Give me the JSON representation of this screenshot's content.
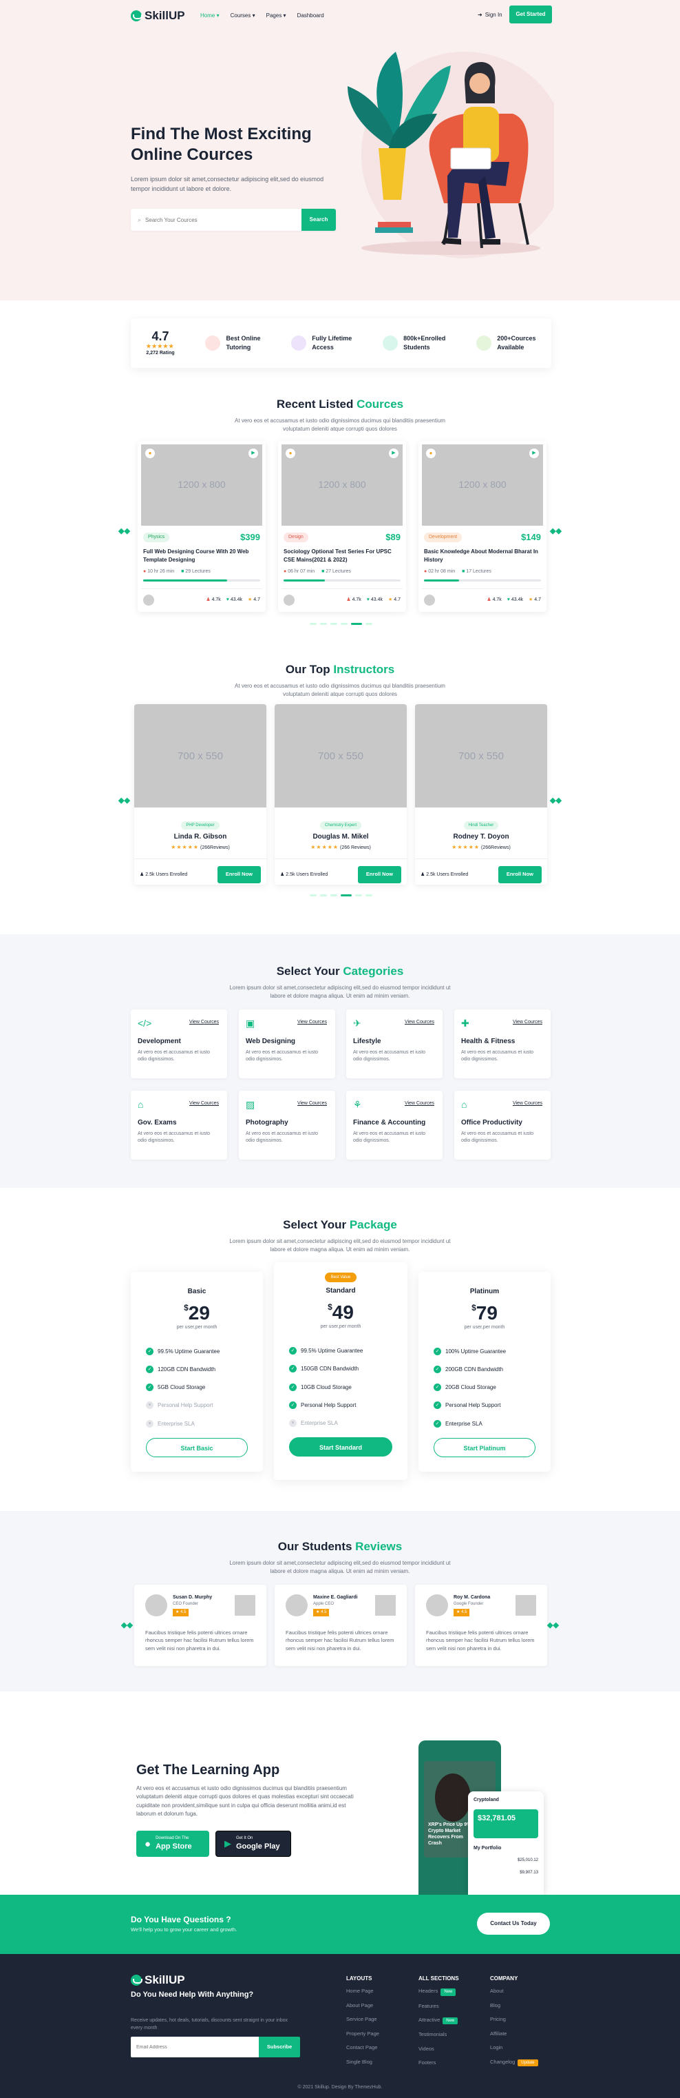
{
  "brand": {
    "name": "SkillUP"
  },
  "nav": {
    "items": [
      "Home",
      "Courses",
      "Pages",
      "Dashboard"
    ],
    "signin": "Sign In",
    "get_started": "Get Started"
  },
  "hero": {
    "title_line1": "Find The Most Exciting",
    "title_line2": "Online Cources",
    "text": "Lorem ipsum dolor sit amet,consectetur adipiscing elit,sed do eiusmod tempor incididunt ut labore et dolore.",
    "search_placeholder": "Search Your Cources",
    "search_button": "Search"
  },
  "stats": {
    "rating_value": "4.7",
    "rating_count": "2,272 Rating",
    "items": [
      {
        "l1": "Best Online",
        "l2": "Tutoring",
        "color": "#fde3e1"
      },
      {
        "l1": "Fully Lifetime",
        "l2": "Access",
        "color": "#ede4fb"
      },
      {
        "l1": "800k+Enrolled",
        "l2": "Students",
        "color": "#d9f6ec"
      },
      {
        "l1": "200+Cources",
        "l2": "Available",
        "color": "#e4f5dc"
      }
    ]
  },
  "courses": {
    "title_a": "Recent Listed",
    "title_b": "Cources",
    "sub": "At vero eos et accusamus et iusto odio dignissimos ducimus qui blanditiis praesentium voluptatum deleniti atque corrupti quos dolores",
    "placeholder": "1200 x 800",
    "items": [
      {
        "tag": "Physics",
        "tag_bg": "#e3f7ec",
        "tag_color": "#22a35b",
        "price": "$399",
        "title": "Full Web Designing Course With 20 Web Template Designing",
        "duration": "10 hr 26 min",
        "lectures": "29 Lectures",
        "progress": 0.72,
        "students": "4.7k",
        "likes": "43.4k",
        "rating": "4.7"
      },
      {
        "tag": "Design",
        "tag_bg": "#fde6e3",
        "tag_color": "#e0564b",
        "price": "$89",
        "title": "Sociology Optional Test Series For UPSC CSE Mains(2021 & 2022)",
        "duration": "06 hr 07 min",
        "lectures": "27 Lectures",
        "progress": 0.35,
        "students": "4.7k",
        "likes": "43.4k",
        "rating": "4.7"
      },
      {
        "tag": "Development",
        "tag_bg": "#fdebde",
        "tag_color": "#e4823a",
        "price": "$149",
        "title": "Basic Knowledge About Modernal Bharat In History",
        "duration": "02 hr 08 min",
        "lectures": "17 Lectures",
        "progress": 0.3,
        "students": "4.7k",
        "likes": "43.4k",
        "rating": "4.7"
      }
    ]
  },
  "instructors": {
    "title_a": "Our Top",
    "title_b": "Instructors",
    "sub": "At vero eos et accusamus et iusto odio dignissimos ducimus qui blanditiis praesentium voluptatum deleniti atque corrupti quos dolores",
    "placeholder": "700 x 550",
    "items": [
      {
        "role": "PHP Developer",
        "name": "Linda R. Gibson",
        "reviews": "(266Reviews)",
        "enrolled": "2.5k Users Enrolled",
        "btn": "Enroll Now"
      },
      {
        "role": "Chemistry Expert",
        "name": "Douglas M. Mikel",
        "reviews": "(266 Reviews)",
        "enrolled": "2.5k Users Enrolled",
        "btn": "Enroll Now"
      },
      {
        "role": "Hindi Teacher",
        "name": "Rodney T. Doyon",
        "reviews": "(266Reviews)",
        "enrolled": "2.5k Users Enrolled",
        "btn": "Enroll Now"
      }
    ]
  },
  "categories": {
    "title_a": "Select Your",
    "title_b": "Categories",
    "sub": "Lorem ipsum dolor sit amet,consectetur adipiscing elit,sed do eiusmod tempor incididunt ut labore et dolore magna aliqua. Ut enim ad minim veniam.",
    "view": "View Cources",
    "desc": "At vero eos et accusamus et iusto odio dignissimos.",
    "items": [
      {
        "name": "Development",
        "icon": "</>"
      },
      {
        "name": "Web Designing",
        "icon": "▣"
      },
      {
        "name": "Lifestyle",
        "icon": "✈"
      },
      {
        "name": "Health & Fitness",
        "icon": "✚"
      },
      {
        "name": "Gov. Exams",
        "icon": "⌂"
      },
      {
        "name": "Photography",
        "icon": "▨"
      },
      {
        "name": "Finance & Accounting",
        "icon": "⚘"
      },
      {
        "name": "Office Productivity",
        "icon": "⌂"
      }
    ]
  },
  "packages": {
    "title_a": "Select Your",
    "title_b": "Package",
    "sub": "Lorem ipsum dolor sit amet,consectetur adipiscing elit,sed do eiusmod tempor incididunt ut labore et dolore magna aliqua. Ut enim ad minim veniam.",
    "per": "per user,per month",
    "plans": [
      {
        "name": "Basic",
        "price": "29",
        "btn": "Start Basic",
        "features": [
          [
            "99.5% Uptime Guarantee",
            true
          ],
          [
            "120GB CDN Bandwidth",
            true
          ],
          [
            "5GB Cloud Storage",
            true
          ],
          [
            "Personal Help Support",
            false
          ],
          [
            "Enterprise SLA",
            false
          ]
        ]
      },
      {
        "name": "Standard",
        "badge": "Best Value",
        "price": "49",
        "btn": "Start Standard",
        "features": [
          [
            "99.5% Uptime Guarantee",
            true
          ],
          [
            "150GB CDN Bandwidth",
            true
          ],
          [
            "10GB Cloud Storage",
            true
          ],
          [
            "Personal Help Support",
            true
          ],
          [
            "Enterprise SLA",
            false
          ]
        ]
      },
      {
        "name": "Platinum",
        "price": "79",
        "btn": "Start Platinum",
        "features": [
          [
            "100% Uptime Guarantee",
            true
          ],
          [
            "200GB CDN Bandwidth",
            true
          ],
          [
            "20GB Cloud Storage",
            true
          ],
          [
            "Personal Help Support",
            true
          ],
          [
            "Enterprise SLA",
            true
          ]
        ]
      }
    ]
  },
  "reviews": {
    "title_a": "Our Students",
    "title_b": "Reviews",
    "sub": "Lorem ipsum dolor sit amet,consectetur adipiscing elit,sed do eiusmod tempor incididunt ut labore et dolore magna aliqua. Ut enim ad minim veniam.",
    "items": [
      {
        "name": "Susan D. Murphy",
        "role": "CEO Founder",
        "rating": "4.5",
        "text": "Faucibus tristique felis potenti ultrices ornare rhoncus semper hac facilisi Rutrum tellus lorem sem velit nisi non pharetra in dui."
      },
      {
        "name": "Maxine E. Gagliardi",
        "role": "Apple CEO",
        "rating": "4.5",
        "text": "Faucibus tristique felis potenti ultrices ornare rhoncus semper hac facilisi Rutrum tellus lorem sem velit nisi non pharetra in dui."
      },
      {
        "name": "Roy M. Cardona",
        "role": "Google Founder",
        "rating": "4.5",
        "text": "Faucibus tristique felis potenti ultrices ornare rhoncus semper hac facilisi Rutrum tellus lorem sem velit nisi non pharetra in dui."
      }
    ]
  },
  "app": {
    "title": "Get The Learning App",
    "text": "At vero eos et accusamus et iusto odio dignissimos ducimus qui blanditiis praesentium voluptatum deleniti atque corrupti quos dolores et quas molestias excepturi sint occaecati cupiditate non provident,similique sunt in culpa qui officia deserunt mollitia animi,id est laborum et dolorum fuga.",
    "apple_small": "Download On The",
    "apple_big": "App Store",
    "google_small": "Get It On",
    "google_big": "Google Play",
    "phone_brand": "Cryptoland",
    "phone_hero": "XRP's Price Up 9%, Crypto Market Recovers From Crash",
    "phone_balance": "$32,781.05",
    "phone_portfolio": "My Portfolio",
    "phone_p1": "$25,010.12",
    "phone_p2": "$9,907.13"
  },
  "cta": {
    "title": "Do You Have Questions ?",
    "sub": "We'll help you to grow your career and growth.",
    "btn": "Contact Us Today"
  },
  "footer": {
    "title": "Do You Need Help With Anything?",
    "text": "Receive updates, hot deals, tutorials, discounts sent straignt in your inbox every month",
    "email_placeholder": "Email Address",
    "subscribe": "Subscribe",
    "copyright": "© 2021 Skillup. Design By ThemezHub.",
    "cols": [
      {
        "title": "LAYOUTS",
        "links": [
          [
            "Home Page",
            ""
          ],
          [
            "About Page",
            ""
          ],
          [
            "Service Page",
            ""
          ],
          [
            "Property Page",
            ""
          ],
          [
            "Contact Page",
            ""
          ],
          [
            "Single Blog",
            ""
          ]
        ]
      },
      {
        "title": "ALL SECTIONS",
        "links": [
          [
            "Headers",
            "New"
          ],
          [
            "Features",
            ""
          ],
          [
            "Attractive",
            "New"
          ],
          [
            "Testimonials",
            ""
          ],
          [
            "Videos",
            ""
          ],
          [
            "Footers",
            ""
          ]
        ]
      },
      {
        "title": "COMPANY",
        "links": [
          [
            "About",
            ""
          ],
          [
            "Blog",
            ""
          ],
          [
            "Pricing",
            ""
          ],
          [
            "Affiliate",
            ""
          ],
          [
            "Login",
            ""
          ],
          [
            "Changelog",
            "Update"
          ]
        ]
      }
    ]
  }
}
